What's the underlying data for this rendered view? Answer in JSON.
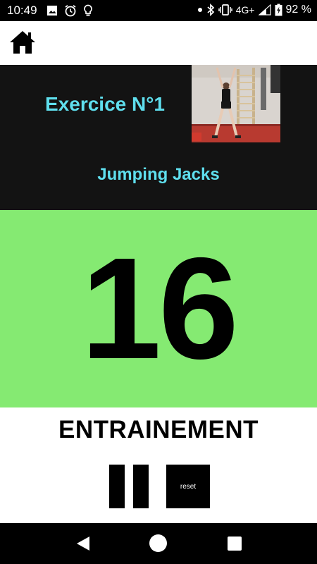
{
  "status_bar": {
    "time": "10:49",
    "network": "4G+",
    "battery_percent": "92 %",
    "icons_left": [
      "image-icon",
      "alarm-icon",
      "lightbulb-icon"
    ],
    "icons_right": [
      "dot-icon",
      "bluetooth-icon",
      "vibrate-icon",
      "signal-icon",
      "battery-charging-icon"
    ]
  },
  "app_bar": {
    "home_icon": "home-icon"
  },
  "exercise": {
    "number_label": "Exercice N°1",
    "name": "Jumping Jacks",
    "title_color": "#5fdfee"
  },
  "counter": {
    "value": "16",
    "background_color": "#85ea72"
  },
  "mode": {
    "label": "ENTRAINEMENT"
  },
  "controls": {
    "pause_icon": "pause-icon",
    "reset_label": "reset"
  },
  "nav_bar": {
    "back_icon": "back-icon",
    "home_icon": "home-circle-icon",
    "recents_icon": "recents-icon"
  }
}
